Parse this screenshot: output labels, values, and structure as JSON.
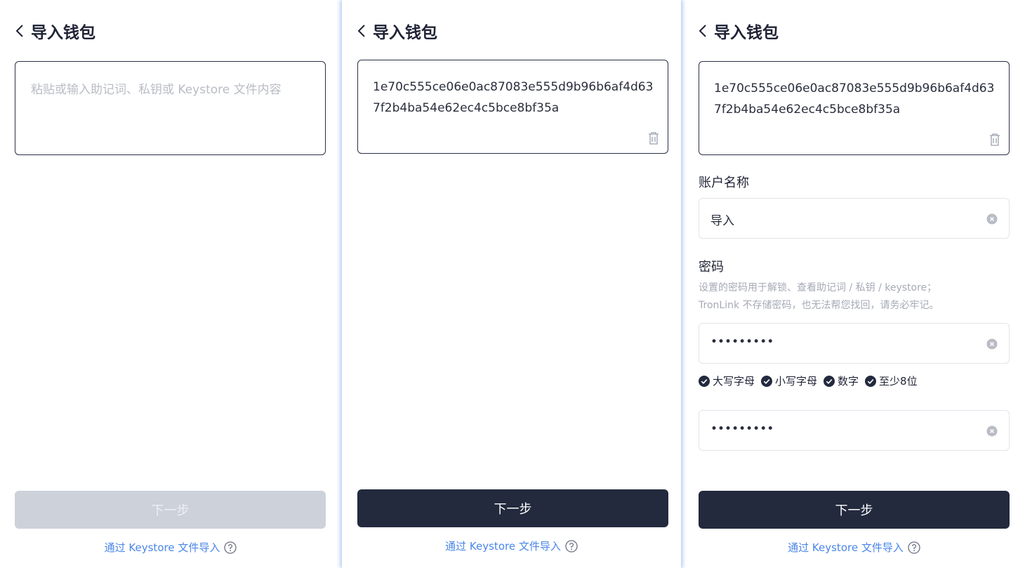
{
  "screens": [
    {
      "title": "导入钱包",
      "input_placeholder": "粘贴或输入助记词、私钥或 Keystore 文件内容",
      "next_button": "下一步",
      "keystore_link": "通过 Keystore 文件导入"
    },
    {
      "title": "导入钱包",
      "input_value": "1e70c555ce06e0ac87083e555d9b96b6af4d637f2b4ba54e62ec4c5bce8bf35a",
      "next_button": "下一步",
      "keystore_link": "通过 Keystore 文件导入"
    },
    {
      "title": "导入钱包",
      "input_value": "1e70c555ce06e0ac87083e555d9b96b6af4d637f2b4ba54e62ec4c5bce8bf35a",
      "account_name_label": "账户名称",
      "account_name_value": "导入",
      "password_label": "密码",
      "password_hint_line1": "设置的密码用于解锁、查看助记词 / 私钥 / keystore；",
      "password_hint_line2": "TronLink 不存储密码，也无法帮您找回，请务必牢记。",
      "password_masked": "•••••••••",
      "confirm_password_masked": "•••••••••",
      "requirements": [
        "大写字母",
        "小写字母",
        "数字",
        "至少8位"
      ],
      "next_button": "下一步",
      "keystore_link": "通过 Keystore 文件导入"
    }
  ],
  "colors": {
    "primary_button": "#232a3e",
    "disabled_button": "#cdd1da",
    "link": "#4a86e8",
    "hint": "#a6aab6"
  },
  "icons": [
    "chevron-left-icon",
    "trash-icon",
    "clear-icon",
    "check-circle-icon",
    "help-circle-icon"
  ]
}
